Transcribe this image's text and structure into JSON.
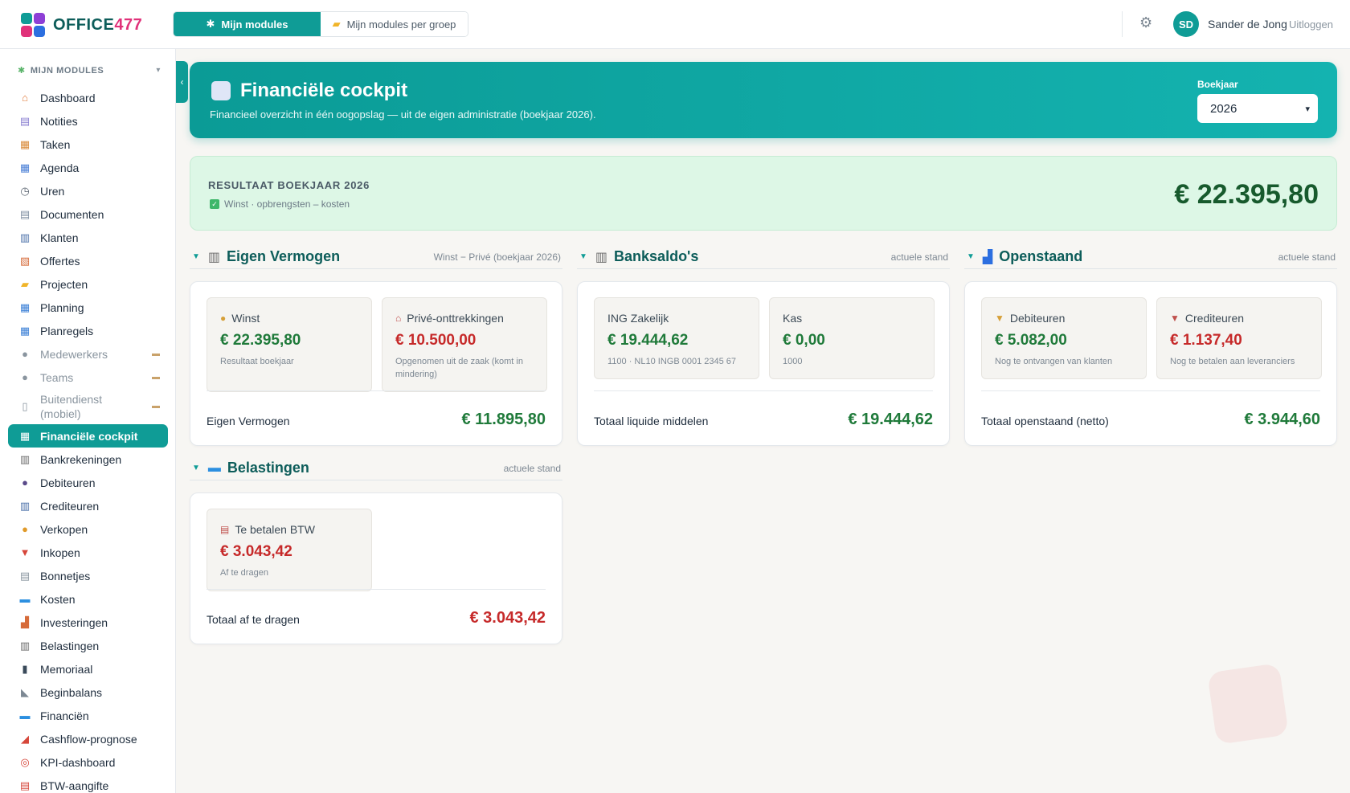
{
  "brand": {
    "name": "OFFICE477",
    "mark_colors": [
      "#0f9c96",
      "#8e3fd6",
      "#e0327a",
      "#2c6fe0"
    ],
    "text_color_a": "#0d5d5a",
    "text_color_b": "#e0327a"
  },
  "topbar": {
    "tabs": [
      {
        "label": "Mijn modules",
        "icon": "puzzle-icon",
        "glyph": "✱",
        "active": true
      },
      {
        "label": "Mijn modules per groep",
        "icon": "folder-icon",
        "glyph": "▰",
        "active": false
      }
    ],
    "settings_icon": "⚙",
    "user_initials": "SD",
    "user_name": "Sander de Jong",
    "logout_label": "Uitloggen"
  },
  "sidebar": {
    "heading": "MIJN MODULES",
    "heading_icon": "✱",
    "collapse_glyph": "‹",
    "items": [
      {
        "label": "Dashboard",
        "icon": "home-icon",
        "glyph": "⌂",
        "state": "normal"
      },
      {
        "label": "Notities",
        "icon": "notes-icon",
        "glyph": "▤",
        "state": "normal"
      },
      {
        "label": "Taken",
        "icon": "clipboard-icon",
        "glyph": "▦",
        "state": "normal"
      },
      {
        "label": "Agenda",
        "icon": "calendar-icon",
        "glyph": "▦",
        "state": "normal"
      },
      {
        "label": "Uren",
        "icon": "clock-icon",
        "glyph": "◷",
        "state": "normal"
      },
      {
        "label": "Documenten",
        "icon": "document-icon",
        "glyph": "▤",
        "state": "normal"
      },
      {
        "label": "Klanten",
        "icon": "building-icon",
        "glyph": "▥",
        "state": "normal"
      },
      {
        "label": "Offertes",
        "icon": "quote-icon",
        "glyph": "▧",
        "state": "normal"
      },
      {
        "label": "Projecten",
        "icon": "folder-icon",
        "glyph": "▰",
        "state": "normal"
      },
      {
        "label": "Planning",
        "icon": "calendar-icon",
        "glyph": "▦",
        "state": "normal"
      },
      {
        "label": "Planregels",
        "icon": "calendar-icon",
        "glyph": "▦",
        "state": "normal"
      },
      {
        "label": "Medewerkers",
        "icon": "user-icon",
        "glyph": "●",
        "state": "locked"
      },
      {
        "label": "Teams",
        "icon": "users-icon",
        "glyph": "●",
        "state": "locked"
      },
      {
        "label": "Buitendienst (mobiel)",
        "icon": "mobile-icon",
        "glyph": "▯",
        "state": "locked"
      },
      {
        "label": "Financiële cockpit",
        "icon": "cockpit-icon",
        "glyph": "▦",
        "state": "active"
      },
      {
        "label": "Bankrekeningen",
        "icon": "bank-icon",
        "glyph": "▥",
        "state": "normal"
      },
      {
        "label": "Debiteuren",
        "icon": "users-icon",
        "glyph": "●",
        "state": "normal"
      },
      {
        "label": "Crediteuren",
        "icon": "building-icon",
        "glyph": "▥",
        "state": "normal"
      },
      {
        "label": "Verkopen",
        "icon": "money-bag-icon",
        "glyph": "●",
        "state": "normal"
      },
      {
        "label": "Inkopen",
        "icon": "inbox-icon",
        "glyph": "▼",
        "state": "normal"
      },
      {
        "label": "Bonnetjes",
        "icon": "receipt-icon",
        "glyph": "▤",
        "state": "normal"
      },
      {
        "label": "Kosten",
        "icon": "banknote-icon",
        "glyph": "▬",
        "state": "normal"
      },
      {
        "label": "Investeringen",
        "icon": "investment-icon",
        "glyph": "▟",
        "state": "normal"
      },
      {
        "label": "Belastingen",
        "icon": "bank-icon",
        "glyph": "▥",
        "state": "normal"
      },
      {
        "label": "Memoriaal",
        "icon": "book-icon",
        "glyph": "▮",
        "state": "normal"
      },
      {
        "label": "Beginbalans",
        "icon": "ruler-icon",
        "glyph": "◣",
        "state": "normal"
      },
      {
        "label": "Financiën",
        "icon": "banknote-icon",
        "glyph": "▬",
        "state": "normal"
      },
      {
        "label": "Cashflow-prognose",
        "icon": "trend-icon",
        "glyph": "◢",
        "state": "normal"
      },
      {
        "label": "KPI-dashboard",
        "icon": "target-icon",
        "glyph": "◎",
        "state": "normal"
      },
      {
        "label": "BTW-aangifte",
        "icon": "receipt-icon",
        "glyph": "▤",
        "state": "normal"
      }
    ],
    "lock_glyph": "▬"
  },
  "hero": {
    "title": "Financiële cockpit",
    "subtitle": "Financieel overzicht in één oogopslag — uit de eigen administratie (boekjaar 2026).",
    "year_label": "Boekjaar",
    "year_value": "2026",
    "caret": "▾"
  },
  "result": {
    "label": "RESULTAAT BOEKJAAR 2026",
    "sub": "Winst · opbrengsten – kosten",
    "value": "€ 22.395,80"
  },
  "sections": {
    "eigen_vermogen": {
      "title": "Eigen Vermogen",
      "note": "Winst − Privé (boekjaar 2026)",
      "icon_glyph": "▥",
      "tiles": [
        {
          "title": "Winst",
          "glyph": "●",
          "value": "€ 22.395,80",
          "sub": "Resultaat boekjaar",
          "tone": "green"
        },
        {
          "title": "Privé-onttrekkingen",
          "glyph": "⌂",
          "value": "€ 10.500,00",
          "sub": "Opgenomen uit de zaak (komt in mindering)",
          "tone": "red"
        }
      ],
      "total_label": "Eigen Vermogen",
      "total_value": "€ 11.895,80",
      "total_tone": "green"
    },
    "banksaldos": {
      "title": "Banksaldo's",
      "note": "actuele stand",
      "icon_glyph": "▥",
      "tiles": [
        {
          "title": "ING Zakelijk",
          "glyph": "",
          "value": "€ 19.444,62",
          "sub": "1100 · NL10 INGB 0001 2345 67",
          "tone": "green"
        },
        {
          "title": "Kas",
          "glyph": "",
          "value": "€ 0,00",
          "sub": "1000",
          "tone": "green"
        }
      ],
      "total_label": "Totaal liquide middelen",
      "total_value": "€ 19.444,62",
      "total_tone": "green"
    },
    "openstaand": {
      "title": "Openstaand",
      "note": "actuele stand",
      "icon_glyph": "▟",
      "tiles": [
        {
          "title": "Debiteuren",
          "glyph": "▼",
          "value": "€ 5.082,00",
          "sub": "Nog te ontvangen van klanten",
          "tone": "green"
        },
        {
          "title": "Crediteuren",
          "glyph": "▼",
          "value": "€ 1.137,40",
          "sub": "Nog te betalen aan leveranciers",
          "tone": "red"
        }
      ],
      "total_label": "Totaal openstaand (netto)",
      "total_value": "€ 3.944,60",
      "total_tone": "green"
    },
    "belastingen": {
      "title": "Belastingen",
      "note": "actuele stand",
      "icon_glyph": "▬",
      "tiles": [
        {
          "title": "Te betalen BTW",
          "glyph": "▤",
          "value": "€ 3.043,42",
          "sub": "Af te dragen",
          "tone": "red"
        }
      ],
      "total_label": "Totaal af te dragen",
      "total_value": "€ 3.043,42",
      "total_tone": "red"
    }
  },
  "section_toggle_glyph": "▼",
  "colors": {
    "accent": "#0f9c96",
    "positive": "#1f7a3a",
    "negative": "#c62a2a",
    "result_bg": "#ddf7e6"
  }
}
